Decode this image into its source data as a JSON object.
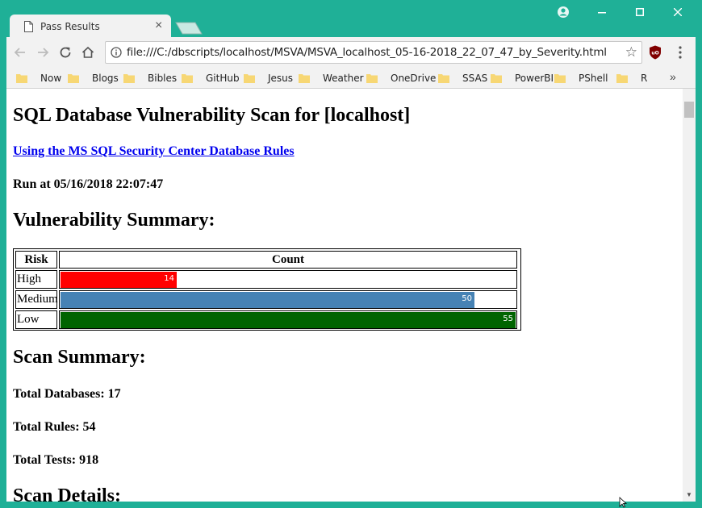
{
  "browser": {
    "tab_title": "Pass Results",
    "tab_close": "×",
    "url": "file:///C:/dbscripts/localhost/MSVA/MSVA_localhost_05-16-2018_22_07_47_by_Severity.html",
    "icons": {
      "back": "arrow-left-icon",
      "forward": "arrow-right-icon",
      "reload": "reload-icon",
      "home": "home-icon",
      "info": "info-icon",
      "star": "star-icon",
      "extension": "ublock-icon",
      "menu": "kebab-menu-icon"
    },
    "bookmarks": [
      "Now",
      "Blogs",
      "Bibles",
      "GitHub",
      "Jesus",
      "Weather",
      "OneDrive",
      "SSAS",
      "PowerBI",
      "PShell",
      "R"
    ],
    "bookmarks_more": "»"
  },
  "page": {
    "title": "SQL Database Vulnerability Scan for [localhost]",
    "rules_link": "Using the MS SQL Security Center Database Rules",
    "run_at": "Run at 05/16/2018 22:07:47",
    "vuln_heading": "Vulnerability Summary:",
    "table_headers": {
      "risk": "Risk",
      "count": "Count"
    },
    "vuln_rows": [
      {
        "risk": "High",
        "count": "14",
        "color": "#ff0000"
      },
      {
        "risk": "Medium",
        "count": "50",
        "color": "#4682b4"
      },
      {
        "risk": "Low",
        "count": "55",
        "color": "#006400"
      }
    ],
    "scan_heading": "Scan Summary:",
    "total_databases": "Total Databases: 17",
    "total_rules": "Total Rules: 54",
    "total_tests": "Total Tests: 918",
    "details_heading": "Scan Details:"
  },
  "colors": {
    "frame": "#1fb097",
    "chrome": "#f2f2f2",
    "link": "#0000ee"
  }
}
